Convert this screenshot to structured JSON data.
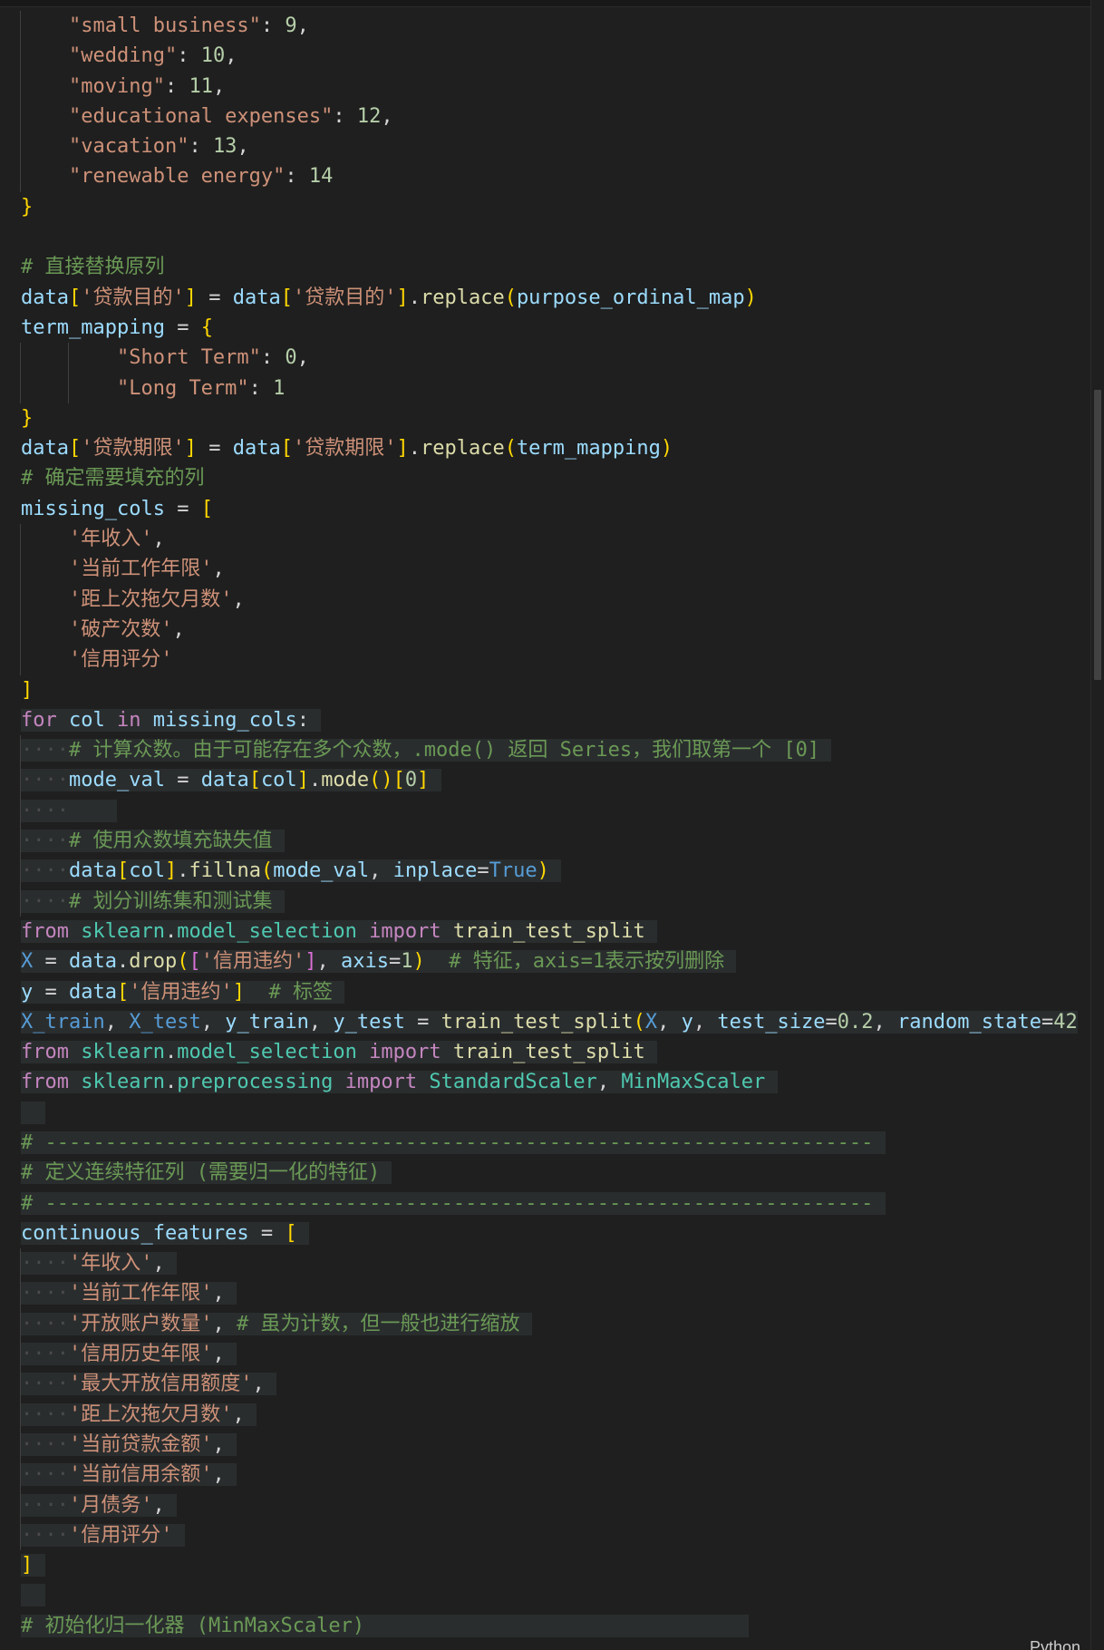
{
  "status": {
    "language": "Python"
  },
  "lines": [
    {
      "indent": 1,
      "tokens": [
        [
          "str",
          "\"small business\""
        ],
        [
          "op",
          ": "
        ],
        [
          "num",
          "9"
        ],
        [
          "op",
          ","
        ]
      ]
    },
    {
      "indent": 1,
      "tokens": [
        [
          "str",
          "\"wedding\""
        ],
        [
          "op",
          ": "
        ],
        [
          "num",
          "10"
        ],
        [
          "op",
          ","
        ]
      ]
    },
    {
      "indent": 1,
      "tokens": [
        [
          "str",
          "\"moving\""
        ],
        [
          "op",
          ": "
        ],
        [
          "num",
          "11"
        ],
        [
          "op",
          ","
        ]
      ]
    },
    {
      "indent": 1,
      "tokens": [
        [
          "str",
          "\"educational expenses\""
        ],
        [
          "op",
          ": "
        ],
        [
          "num",
          "12"
        ],
        [
          "op",
          ","
        ]
      ]
    },
    {
      "indent": 1,
      "tokens": [
        [
          "str",
          "\"vacation\""
        ],
        [
          "op",
          ": "
        ],
        [
          "num",
          "13"
        ],
        [
          "op",
          ","
        ]
      ]
    },
    {
      "indent": 1,
      "tokens": [
        [
          "str",
          "\"renewable energy\""
        ],
        [
          "op",
          ": "
        ],
        [
          "num",
          "14"
        ]
      ]
    },
    {
      "indent": 0,
      "tokens": [
        [
          "br1",
          "}"
        ]
      ]
    },
    {
      "indent": 0,
      "tokens": []
    },
    {
      "indent": 0,
      "tokens": [
        [
          "cm",
          "# 直接替换原列"
        ]
      ]
    },
    {
      "indent": 0,
      "tokens": [
        [
          "var",
          "data"
        ],
        [
          "br1",
          "["
        ],
        [
          "str",
          "'贷款目的'"
        ],
        [
          "br1",
          "]"
        ],
        [
          "op",
          " = "
        ],
        [
          "var",
          "data"
        ],
        [
          "br1",
          "["
        ],
        [
          "str",
          "'贷款目的'"
        ],
        [
          "br1",
          "]"
        ],
        [
          "op",
          "."
        ],
        [
          "fn",
          "replace"
        ],
        [
          "br1",
          "("
        ],
        [
          "var",
          "purpose_ordinal_map"
        ],
        [
          "br1",
          ")"
        ]
      ]
    },
    {
      "indent": 0,
      "tokens": [
        [
          "var",
          "term_mapping"
        ],
        [
          "op",
          " = "
        ],
        [
          "br1",
          "{"
        ]
      ]
    },
    {
      "indent": 2,
      "tokens": [
        [
          "str",
          "\"Short Term\""
        ],
        [
          "op",
          ": "
        ],
        [
          "num",
          "0"
        ],
        [
          "op",
          ","
        ]
      ]
    },
    {
      "indent": 2,
      "tokens": [
        [
          "str",
          "\"Long Term\""
        ],
        [
          "op",
          ": "
        ],
        [
          "num",
          "1"
        ]
      ]
    },
    {
      "indent": 0,
      "tokens": [
        [
          "br1",
          "}"
        ]
      ]
    },
    {
      "indent": 0,
      "tokens": [
        [
          "var",
          "data"
        ],
        [
          "br1",
          "["
        ],
        [
          "str",
          "'贷款期限'"
        ],
        [
          "br1",
          "]"
        ],
        [
          "op",
          " = "
        ],
        [
          "var",
          "data"
        ],
        [
          "br1",
          "["
        ],
        [
          "str",
          "'贷款期限'"
        ],
        [
          "br1",
          "]"
        ],
        [
          "op",
          "."
        ],
        [
          "fn",
          "replace"
        ],
        [
          "br1",
          "("
        ],
        [
          "var",
          "term_mapping"
        ],
        [
          "br1",
          ")"
        ]
      ]
    },
    {
      "indent": 0,
      "tokens": [
        [
          "cm",
          "# 确定需要填充的列"
        ]
      ]
    },
    {
      "indent": 0,
      "tokens": [
        [
          "var",
          "missing_cols"
        ],
        [
          "op",
          " = "
        ],
        [
          "br1",
          "["
        ]
      ]
    },
    {
      "indent": 1,
      "tokens": [
        [
          "str",
          "'年收入'"
        ],
        [
          "op",
          ","
        ]
      ]
    },
    {
      "indent": 1,
      "tokens": [
        [
          "str",
          "'当前工作年限'"
        ],
        [
          "op",
          ","
        ]
      ]
    },
    {
      "indent": 1,
      "tokens": [
        [
          "str",
          "'距上次拖欠月数'"
        ],
        [
          "op",
          ","
        ]
      ]
    },
    {
      "indent": 1,
      "tokens": [
        [
          "str",
          "'破产次数'"
        ],
        [
          "op",
          ","
        ]
      ]
    },
    {
      "indent": 1,
      "tokens": [
        [
          "str",
          "'信用评分'"
        ]
      ]
    },
    {
      "indent": 0,
      "tokens": [
        [
          "br1",
          "]"
        ]
      ]
    },
    {
      "indent": 0,
      "hl": true,
      "tokens": [
        [
          "kw",
          "for"
        ],
        [
          "op",
          " "
        ],
        [
          "var",
          "col"
        ],
        [
          "op",
          " "
        ],
        [
          "kw",
          "in"
        ],
        [
          "op",
          " "
        ],
        [
          "var",
          "missing_cols"
        ],
        [
          "op",
          ": "
        ]
      ]
    },
    {
      "indent": 1,
      "hl": true,
      "dots": true,
      "tokens": [
        [
          "cm",
          "# 计算众数。由于可能存在多个众数，.mode() 返回 Series，我们取第一个 [0] "
        ]
      ]
    },
    {
      "indent": 1,
      "hl": true,
      "dots": true,
      "tokens": [
        [
          "var",
          "mode_val"
        ],
        [
          "op",
          " = "
        ],
        [
          "var",
          "data"
        ],
        [
          "br1",
          "["
        ],
        [
          "var",
          "col"
        ],
        [
          "br1",
          "]"
        ],
        [
          "op",
          "."
        ],
        [
          "fn",
          "mode"
        ],
        [
          "br1",
          "()"
        ],
        [
          "br1",
          "["
        ],
        [
          "num",
          "0"
        ],
        [
          "br1",
          "]"
        ],
        [
          "op",
          " "
        ]
      ]
    },
    {
      "indent": 1,
      "hl": true,
      "dots": true,
      "tokens": [
        [
          "op",
          "    "
        ]
      ]
    },
    {
      "indent": 1,
      "hl": true,
      "dots": true,
      "tokens": [
        [
          "cm",
          "# 使用众数填充缺失值 "
        ]
      ]
    },
    {
      "indent": 1,
      "hl": true,
      "dots": true,
      "tokens": [
        [
          "var",
          "data"
        ],
        [
          "br1",
          "["
        ],
        [
          "var",
          "col"
        ],
        [
          "br1",
          "]"
        ],
        [
          "op",
          "."
        ],
        [
          "fn",
          "fillna"
        ],
        [
          "br1",
          "("
        ],
        [
          "var",
          "mode_val"
        ],
        [
          "op",
          ", "
        ],
        [
          "var",
          "inplace"
        ],
        [
          "op",
          "="
        ],
        [
          "bl",
          "True"
        ],
        [
          "br1",
          ")"
        ],
        [
          "op",
          " "
        ]
      ]
    },
    {
      "indent": 1,
      "hl": true,
      "dots": true,
      "tokens": [
        [
          "cm",
          "# 划分训练集和测试集 "
        ]
      ]
    },
    {
      "indent": 0,
      "hl": true,
      "tokens": [
        [
          "kw",
          "from"
        ],
        [
          "op",
          " "
        ],
        [
          "cls",
          "sklearn"
        ],
        [
          "op",
          "."
        ],
        [
          "cls",
          "model_selection"
        ],
        [
          "op",
          " "
        ],
        [
          "kw",
          "import"
        ],
        [
          "op",
          " "
        ],
        [
          "fn",
          "train_test_split"
        ],
        [
          "op",
          " "
        ]
      ]
    },
    {
      "indent": 0,
      "hl": true,
      "tokens": [
        [
          "bl",
          "X"
        ],
        [
          "op",
          " = "
        ],
        [
          "var",
          "data"
        ],
        [
          "op",
          "."
        ],
        [
          "fn",
          "drop"
        ],
        [
          "br1",
          "("
        ],
        [
          "br2",
          "["
        ],
        [
          "str",
          "'信用违约'"
        ],
        [
          "br2",
          "]"
        ],
        [
          "op",
          ", "
        ],
        [
          "var",
          "axis"
        ],
        [
          "op",
          "="
        ],
        [
          "num",
          "1"
        ],
        [
          "br1",
          ")"
        ],
        [
          "op",
          "  "
        ],
        [
          "cm",
          "# 特征，axis=1表示按列删除 "
        ]
      ]
    },
    {
      "indent": 0,
      "hl": true,
      "tokens": [
        [
          "var",
          "y"
        ],
        [
          "op",
          " = "
        ],
        [
          "var",
          "data"
        ],
        [
          "br1",
          "["
        ],
        [
          "str",
          "'信用违约'"
        ],
        [
          "br1",
          "]"
        ],
        [
          "op",
          "  "
        ],
        [
          "cm",
          "# 标签 "
        ]
      ]
    },
    {
      "indent": 0,
      "hl": true,
      "tokens": [
        [
          "bl",
          "X_train"
        ],
        [
          "op",
          ", "
        ],
        [
          "bl",
          "X_test"
        ],
        [
          "op",
          ", "
        ],
        [
          "var",
          "y_train"
        ],
        [
          "op",
          ", "
        ],
        [
          "var",
          "y_test"
        ],
        [
          "op",
          " = "
        ],
        [
          "fn",
          "train_test_split"
        ],
        [
          "br1",
          "("
        ],
        [
          "bl",
          "X"
        ],
        [
          "op",
          ", "
        ],
        [
          "var",
          "y"
        ],
        [
          "op",
          ", "
        ],
        [
          "var",
          "test_size"
        ],
        [
          "op",
          "="
        ],
        [
          "num",
          "0.2"
        ],
        [
          "op",
          ", "
        ],
        [
          "var",
          "random_state"
        ],
        [
          "op",
          "="
        ],
        [
          "num",
          "42"
        ]
      ]
    },
    {
      "indent": 0,
      "hl": true,
      "tokens": [
        [
          "kw",
          "from"
        ],
        [
          "op",
          " "
        ],
        [
          "cls",
          "sklearn"
        ],
        [
          "op",
          "."
        ],
        [
          "cls",
          "model_selection"
        ],
        [
          "op",
          " "
        ],
        [
          "kw",
          "import"
        ],
        [
          "op",
          " "
        ],
        [
          "fn",
          "train_test_split"
        ],
        [
          "op",
          " "
        ]
      ]
    },
    {
      "indent": 0,
      "hl": true,
      "tokens": [
        [
          "kw",
          "from"
        ],
        [
          "op",
          " "
        ],
        [
          "cls",
          "sklearn"
        ],
        [
          "op",
          "."
        ],
        [
          "cls",
          "preprocessing"
        ],
        [
          "op",
          " "
        ],
        [
          "kw",
          "import"
        ],
        [
          "op",
          " "
        ],
        [
          "cls",
          "StandardScaler"
        ],
        [
          "op",
          ", "
        ],
        [
          "cls",
          "MinMaxScaler"
        ],
        [
          "op",
          " "
        ]
      ]
    },
    {
      "indent": 0,
      "hl": true,
      "tokens": [
        [
          "op",
          "  "
        ]
      ]
    },
    {
      "indent": 0,
      "hl": true,
      "tokens": [
        [
          "cm",
          "# --------------------------------------------------------------------- "
        ]
      ]
    },
    {
      "indent": 0,
      "hl": true,
      "tokens": [
        [
          "cm",
          "# 定义连续特征列 (需要归一化的特征) "
        ]
      ]
    },
    {
      "indent": 0,
      "hl": true,
      "tokens": [
        [
          "cm",
          "# --------------------------------------------------------------------- "
        ]
      ]
    },
    {
      "indent": 0,
      "hl": true,
      "tokens": [
        [
          "var",
          "continuous_features"
        ],
        [
          "op",
          " = "
        ],
        [
          "br1",
          "["
        ],
        [
          "op",
          " "
        ]
      ]
    },
    {
      "indent": 1,
      "hl": true,
      "dots": true,
      "tokens": [
        [
          "str",
          "'年收入'"
        ],
        [
          "op",
          ", "
        ]
      ]
    },
    {
      "indent": 1,
      "hl": true,
      "dots": true,
      "tokens": [
        [
          "str",
          "'当前工作年限'"
        ],
        [
          "op",
          ", "
        ]
      ]
    },
    {
      "indent": 1,
      "hl": true,
      "dots": true,
      "tokens": [
        [
          "str",
          "'开放账户数量'"
        ],
        [
          "op",
          ", "
        ],
        [
          "cm",
          "# 虽为计数，但一般也进行缩放 "
        ]
      ]
    },
    {
      "indent": 1,
      "hl": true,
      "dots": true,
      "tokens": [
        [
          "str",
          "'信用历史年限'"
        ],
        [
          "op",
          ", "
        ]
      ]
    },
    {
      "indent": 1,
      "hl": true,
      "dots": true,
      "tokens": [
        [
          "str",
          "'最大开放信用额度'"
        ],
        [
          "op",
          ", "
        ]
      ]
    },
    {
      "indent": 1,
      "hl": true,
      "dots": true,
      "tokens": [
        [
          "str",
          "'距上次拖欠月数'"
        ],
        [
          "op",
          ", "
        ]
      ]
    },
    {
      "indent": 1,
      "hl": true,
      "dots": true,
      "tokens": [
        [
          "str",
          "'当前贷款金额'"
        ],
        [
          "op",
          ", "
        ]
      ]
    },
    {
      "indent": 1,
      "hl": true,
      "dots": true,
      "tokens": [
        [
          "str",
          "'当前信用余额'"
        ],
        [
          "op",
          ", "
        ]
      ]
    },
    {
      "indent": 1,
      "hl": true,
      "dots": true,
      "tokens": [
        [
          "str",
          "'月债务'"
        ],
        [
          "op",
          ", "
        ]
      ]
    },
    {
      "indent": 1,
      "hl": true,
      "dots": true,
      "tokens": [
        [
          "str",
          "'信用评分'"
        ],
        [
          "op",
          " "
        ]
      ]
    },
    {
      "indent": 0,
      "hl": true,
      "tokens": [
        [
          "br1",
          "]"
        ],
        [
          "op",
          " "
        ]
      ]
    },
    {
      "indent": 0,
      "hl": true,
      "tokens": [
        [
          "op",
          "  "
        ]
      ]
    },
    {
      "indent": 0,
      "hl": true,
      "tokens": [
        [
          "cm",
          "# 初始化归一化器 (MinMaxScaler)                                "
        ]
      ]
    }
  ]
}
